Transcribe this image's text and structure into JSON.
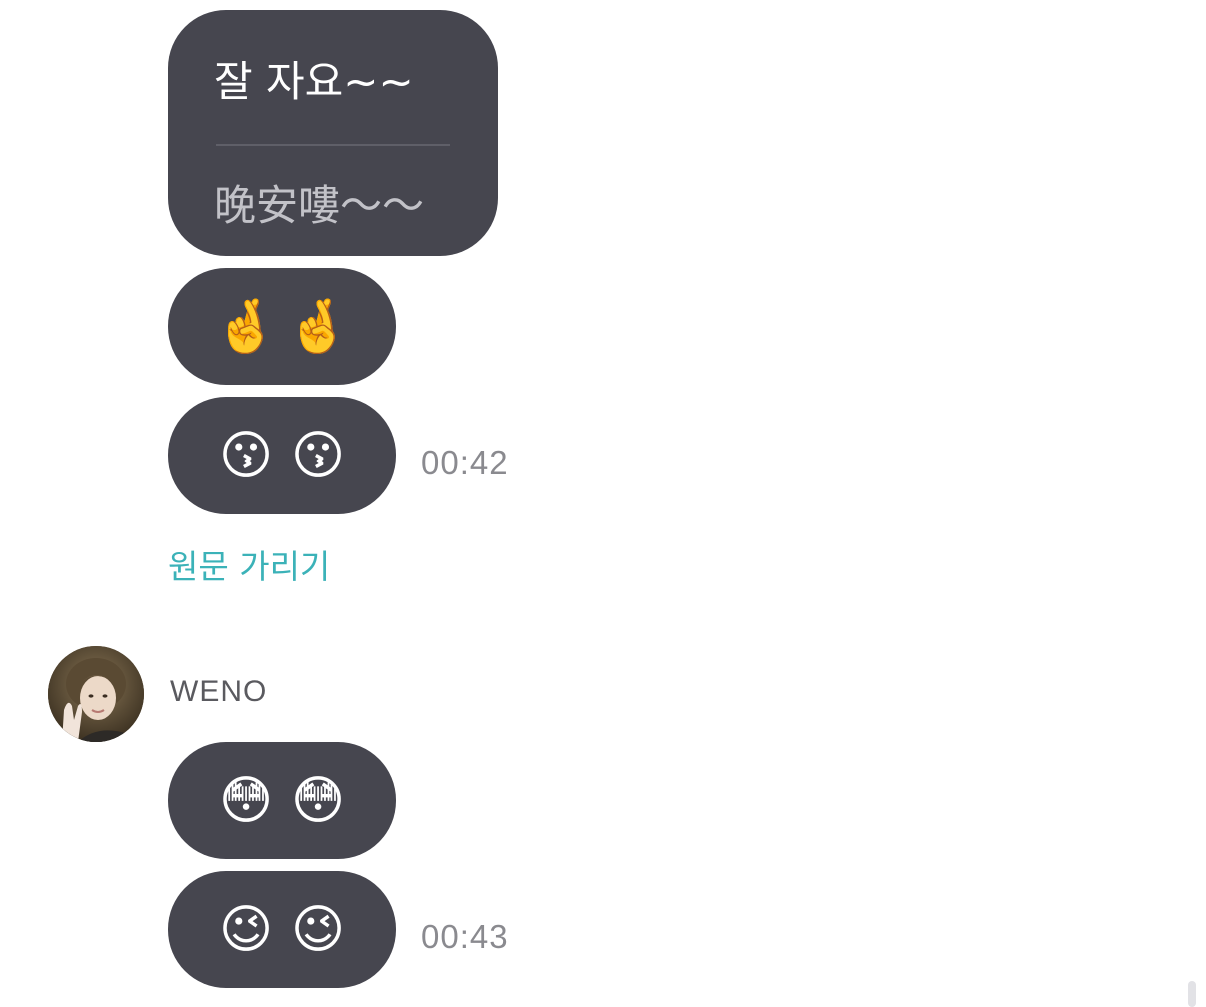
{
  "messages_before": {
    "translated_bubble": {
      "original_text": "잘 자요~~",
      "translated_text": "晚安嘍～～"
    },
    "emoji_bubble_1": {
      "emojis": [
        "🤞",
        "🤞"
      ]
    },
    "emoji_bubble_2": {
      "emojis": [
        "😗",
        "😗"
      ],
      "time": "00:42"
    },
    "toggle_label": "원문 가리기"
  },
  "sender": {
    "name": "WENO",
    "avatar_icon": "avatar-photo"
  },
  "messages_after": {
    "emoji_bubble_3": {
      "emojis": [
        "😳",
        "😳"
      ]
    },
    "emoji_bubble_4": {
      "emojis": [
        "😉",
        "😉"
      ],
      "time": "00:43"
    }
  },
  "colors": {
    "bubble": "#46464f",
    "accent": "#3bb2b8",
    "timestamp": "#8a8a8f"
  }
}
